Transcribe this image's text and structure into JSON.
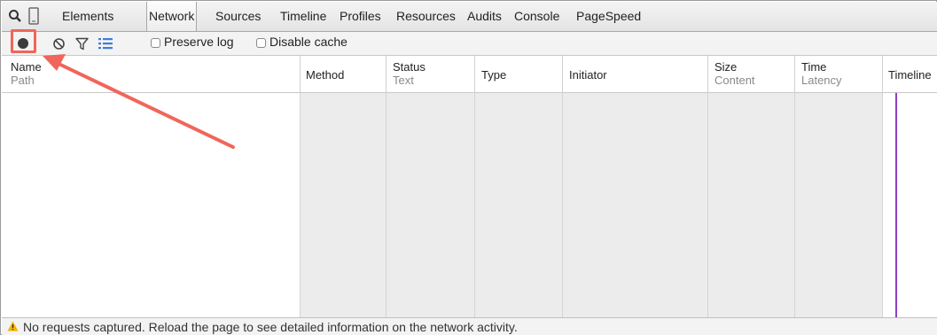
{
  "tabs": [
    {
      "label": "Elements",
      "active": false
    },
    {
      "label": "Network",
      "active": true
    },
    {
      "label": "Sources",
      "active": false
    },
    {
      "label": "Timeline",
      "active": false
    },
    {
      "label": "Profiles",
      "active": false
    },
    {
      "label": "Resources",
      "active": false
    },
    {
      "label": "Audits",
      "active": false
    },
    {
      "label": "Console",
      "active": false
    },
    {
      "label": "PageSpeed",
      "active": false
    }
  ],
  "toolbar": {
    "icons": [
      "record-icon",
      "clear-icon",
      "filter-icon",
      "list-view-icon"
    ],
    "preserve_log_label": "Preserve log",
    "disable_cache_label": "Disable cache",
    "preserve_log_checked": false,
    "disable_cache_checked": false
  },
  "columns": [
    {
      "title": "Name",
      "subtitle": "Path"
    },
    {
      "title": "Method",
      "subtitle": ""
    },
    {
      "title": "Status",
      "subtitle": "Text"
    },
    {
      "title": "Type",
      "subtitle": ""
    },
    {
      "title": "Initiator",
      "subtitle": ""
    },
    {
      "title": "Size",
      "subtitle": "Content"
    },
    {
      "title": "Time",
      "subtitle": "Latency"
    },
    {
      "title": "Timeline",
      "subtitle": ""
    }
  ],
  "status": {
    "message": "No requests captured. Reload the page to see detailed information on the network activity."
  },
  "colors": {
    "highlight": "#f0665a",
    "timeline_marker": "#8b3fc8",
    "warning": "#f0b400",
    "list_icon": "#3b7de0"
  }
}
